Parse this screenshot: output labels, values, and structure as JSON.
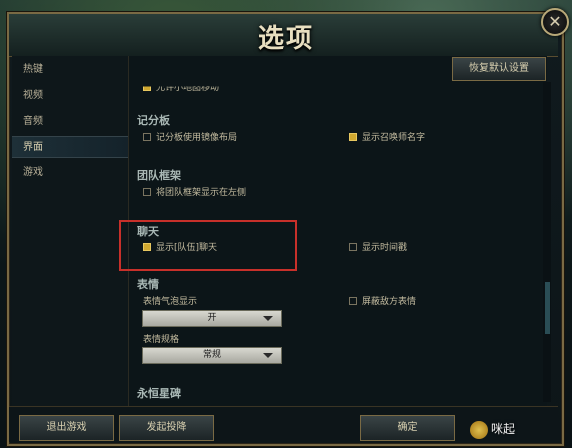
{
  "window": {
    "title": "选项",
    "close_symbol": "✕"
  },
  "sidebar": {
    "items": [
      {
        "label": "热键",
        "active": false
      },
      {
        "label": "视频",
        "active": false
      },
      {
        "label": "音频",
        "active": false
      },
      {
        "label": "界面",
        "active": true
      },
      {
        "label": "游戏",
        "active": false
      }
    ]
  },
  "toolbar": {
    "reset_label": "恢复默认设置"
  },
  "content": {
    "partial_top_option": "允许小地图移动",
    "scoreboard": {
      "title": "记分板",
      "opt_portrait": "记分板使用镜像布局",
      "opt_summoner": "显示召唤师名字"
    },
    "team_frame": {
      "title": "团队框架",
      "opt_left": "将团队框架显示在左侧"
    },
    "chat": {
      "title": "聊天",
      "opt_party": "显示[队伍]聊天",
      "opt_timestamp": "显示时间戳"
    },
    "emotes": {
      "title": "表情",
      "label_bubble": "表情气泡显示",
      "bubble_value": "开",
      "label_scale": "表情规格",
      "scale_value": "常规",
      "opt_mute_enemy": "屏蔽敌方表情"
    },
    "eternal": {
      "title": "永恒星碑"
    }
  },
  "bottom": {
    "exit_label": "退出游戏",
    "surrender_label": "发起投降",
    "ok_label": "确定"
  },
  "watermark": {
    "text": "咪起"
  },
  "colors": {
    "accent_gold": "#d0a830",
    "highlight_red": "#c8302a",
    "frame_gold": "#7a6a44"
  }
}
